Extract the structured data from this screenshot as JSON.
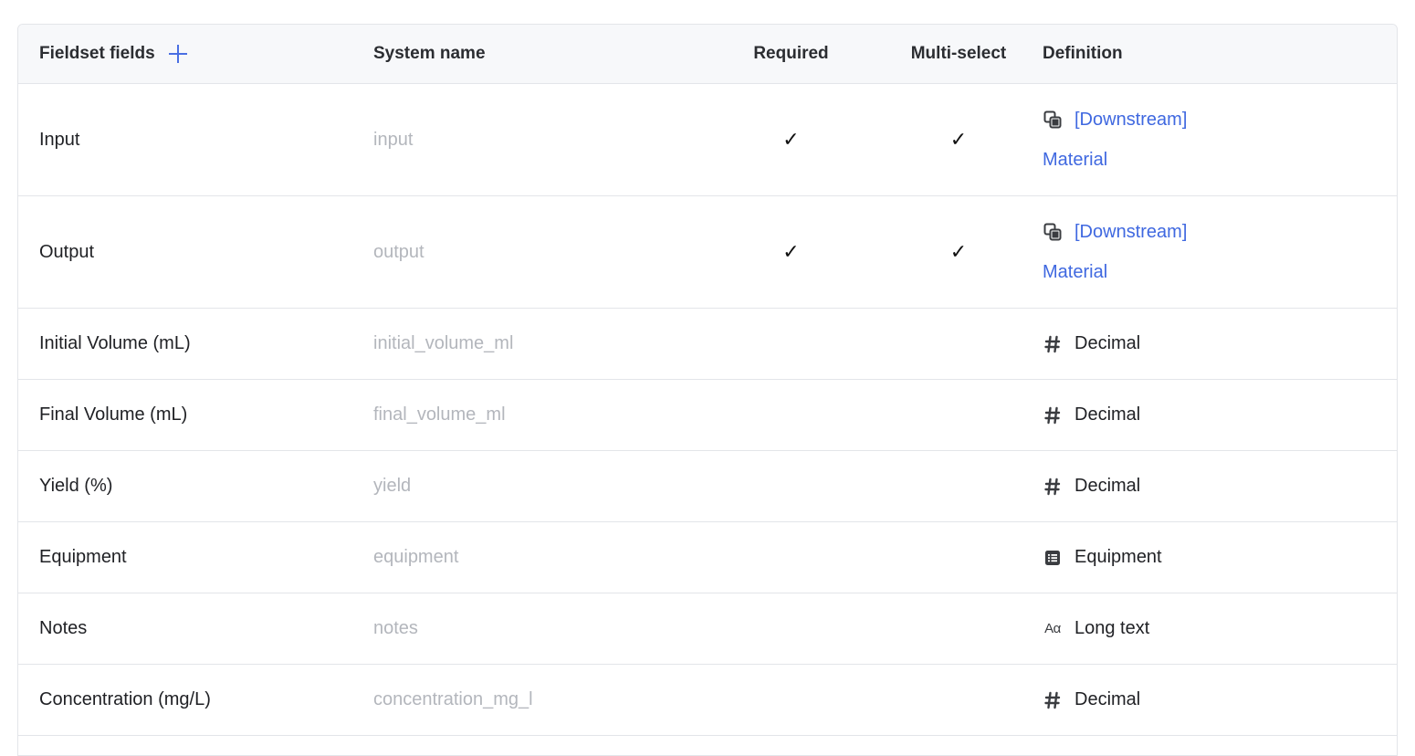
{
  "table": {
    "headers": {
      "field": "Fieldset fields",
      "system_name": "System name",
      "required": "Required",
      "multi_select": "Multi-select",
      "definition": "Definition"
    },
    "check_glyph": "✓",
    "link_color": "#3f68e0",
    "rows": [
      {
        "field": "Input",
        "system_name": "input",
        "required": true,
        "multi_select": true,
        "definition_icon": "linked-entity-icon",
        "definition_link_line1": "[Downstream]",
        "definition_link_line2": "Material"
      },
      {
        "field": "Output",
        "system_name": "output",
        "required": true,
        "multi_select": true,
        "definition_icon": "linked-entity-icon",
        "definition_link_line1": "[Downstream]",
        "definition_link_line2": "Material"
      },
      {
        "field": "Initial Volume (mL)",
        "system_name": "initial_volume_ml",
        "required": false,
        "multi_select": false,
        "definition_icon": "hash-icon",
        "definition": "Decimal"
      },
      {
        "field": "Final Volume (mL)",
        "system_name": "final_volume_ml",
        "required": false,
        "multi_select": false,
        "definition_icon": "hash-icon",
        "definition": "Decimal"
      },
      {
        "field": "Yield (%)",
        "system_name": "yield",
        "required": false,
        "multi_select": false,
        "definition_icon": "hash-icon",
        "definition": "Decimal"
      },
      {
        "field": "Equipment",
        "system_name": "equipment",
        "required": false,
        "multi_select": false,
        "definition_icon": "list-icon",
        "definition": "Equipment"
      },
      {
        "field": "Notes",
        "system_name": "notes",
        "required": false,
        "multi_select": false,
        "definition_icon": "text-icon",
        "definition_icon_text": "Aα",
        "definition": "Long text"
      },
      {
        "field": "Concentration (mg/L)",
        "system_name": "concentration_mg_l",
        "required": false,
        "multi_select": false,
        "definition_icon": "hash-icon",
        "definition": "Decimal"
      }
    ]
  }
}
